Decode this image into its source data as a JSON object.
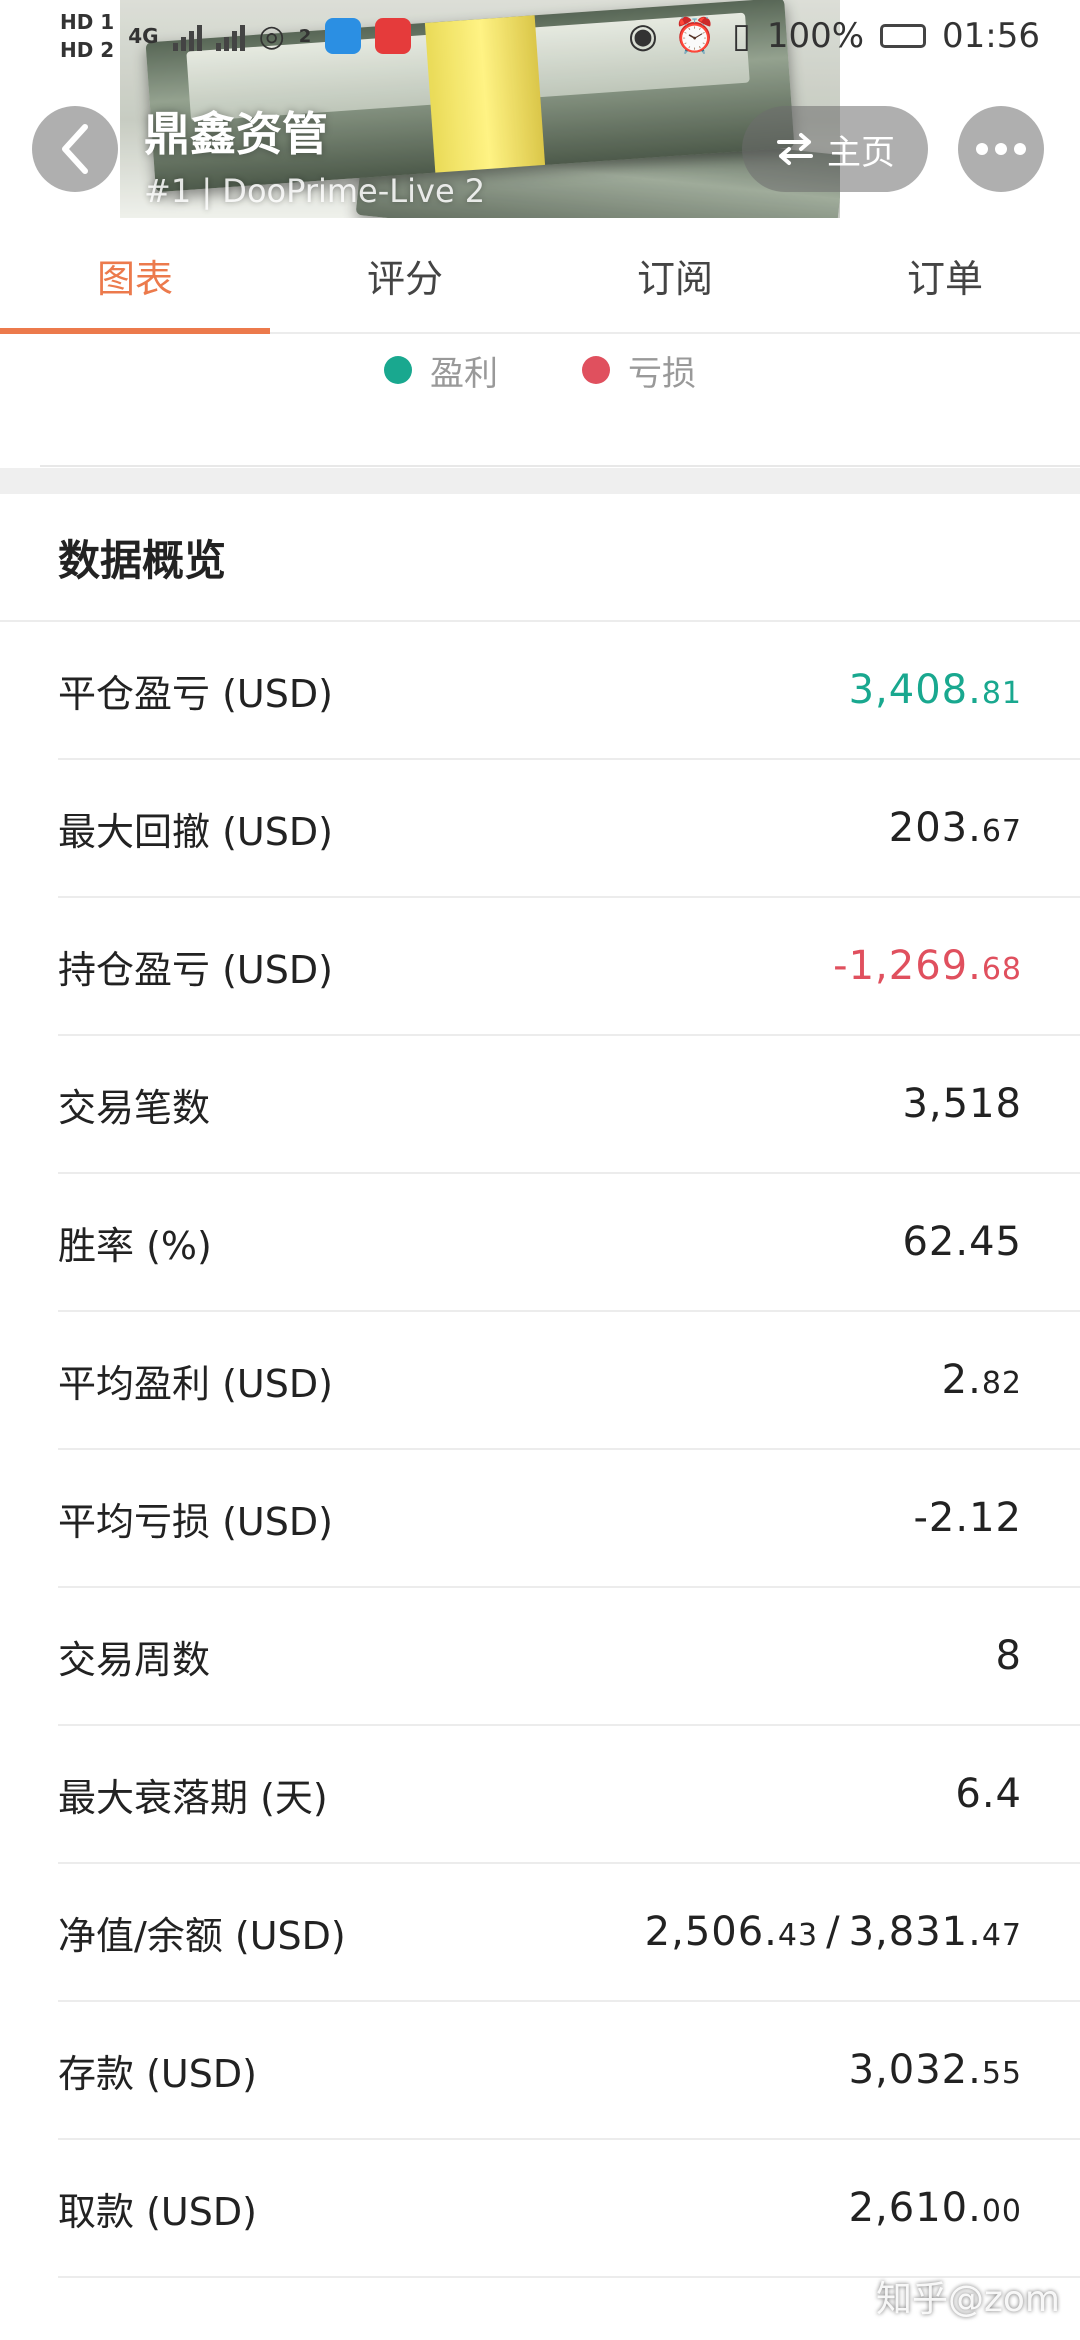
{
  "status_bar": {
    "left_labels": [
      "HD 1",
      "HD 2"
    ],
    "network": "4G",
    "hotspot_count": "2",
    "battery": "100%",
    "time": "01:56"
  },
  "header": {
    "title": "鼎鑫资管",
    "subtitle": "#1 | DooPrime-Live 2",
    "home_label": "主页"
  },
  "tabs": [
    {
      "label": "图表",
      "active": true
    },
    {
      "label": "评分",
      "active": false
    },
    {
      "label": "订阅",
      "active": false
    },
    {
      "label": "订单",
      "active": false
    }
  ],
  "legend": [
    {
      "label": "盈利",
      "color": "#19a88f"
    },
    {
      "label": "亏损",
      "color": "#e0505e"
    }
  ],
  "overview": {
    "title": "数据概览",
    "rows": [
      {
        "label": "平仓盈亏 (USD)",
        "int": "3,408.",
        "dec": "81",
        "tone": "pos"
      },
      {
        "label": "最大回撤 (USD)",
        "int": "203.",
        "dec": "67",
        "tone": ""
      },
      {
        "label": "持仓盈亏 (USD)",
        "int": "-1,269.",
        "dec": "68",
        "tone": "neg"
      },
      {
        "label": "交易笔数",
        "int": "3,518",
        "dec": "",
        "tone": ""
      },
      {
        "label": "胜率 (%)",
        "int": "62.45",
        "dec": "",
        "tone": ""
      },
      {
        "label": "平均盈利 (USD)",
        "int": "2.",
        "dec": "82",
        "tone": ""
      },
      {
        "label": "平均亏损 (USD)",
        "int": "-2.12",
        "dec": "",
        "tone": ""
      },
      {
        "label": "交易周数",
        "int": "8",
        "dec": "",
        "tone": ""
      },
      {
        "label": "最大衰落期 (天)",
        "int": "6.4",
        "dec": "",
        "tone": ""
      },
      {
        "label": "净值/余额 (USD)",
        "int": "2,506.",
        "dec": "43",
        "sep": "/",
        "int2": "3,831.",
        "dec2": "47",
        "tone": ""
      },
      {
        "label": "存款 (USD)",
        "int": "3,032.",
        "dec": "55",
        "tone": ""
      },
      {
        "label": "取款 (USD)",
        "int": "2,610.",
        "dec": "00",
        "tone": ""
      }
    ]
  },
  "watermark": "知乎@zom"
}
